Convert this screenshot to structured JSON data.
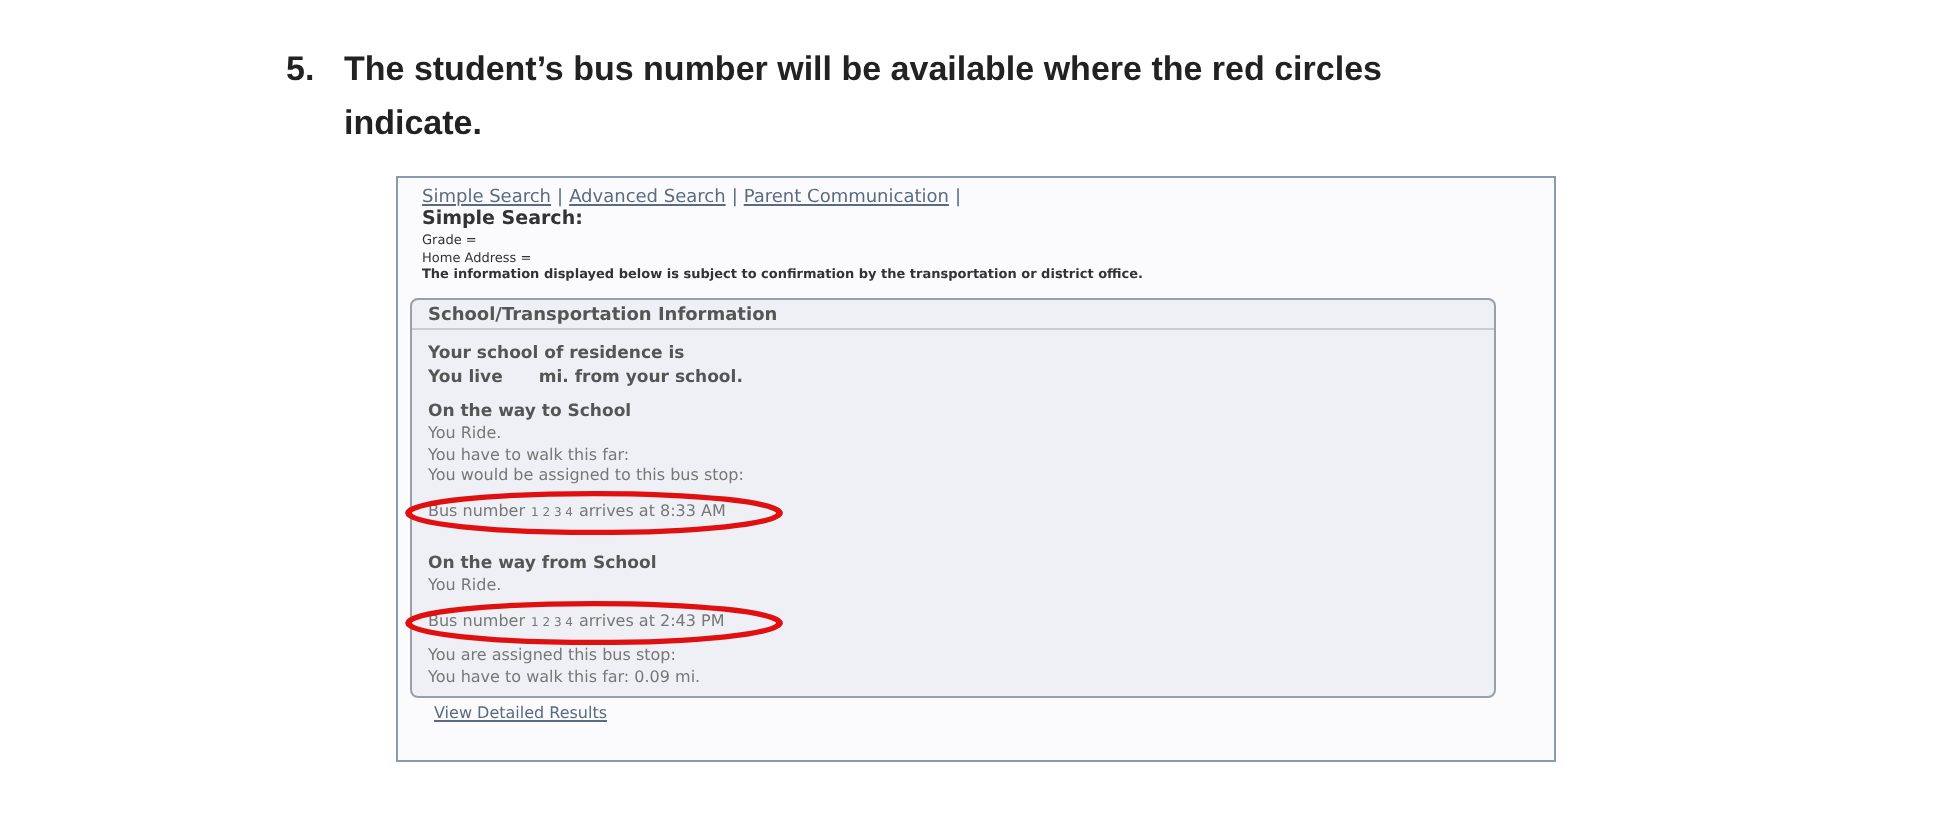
{
  "step": {
    "number": "5.",
    "text": "The student’s bus number will be available where the red circles indicate."
  },
  "screenshot": {
    "nav_links": [
      "Simple Search",
      "Advanced Search",
      "Parent Communication"
    ],
    "nav_separator": "|",
    "search_title": "Simple Search:",
    "criteria": [
      "Grade =",
      "Home Address ="
    ],
    "notice": "The information displayed below is subject to confirmation by the transportation or district office.",
    "panel": {
      "title": "School/Transportation Information",
      "residence": "Your school of residence is",
      "distance": [
        "You live",
        "mi. from your school."
      ],
      "sections": [
        {
          "heading": "On the way to School",
          "lines": [
            {
              "kind": "text",
              "text": "You Ride."
            },
            {
              "kind": "text",
              "text": "You have to walk this far:"
            },
            {
              "kind": "text",
              "text": "You would be assigned to this bus stop:"
            },
            {
              "kind": "bus",
              "prefix": "Bus number",
              "number": "1 2 3 4",
              "suffix": "arrives at 8:33 AM",
              "circled": true
            }
          ]
        },
        {
          "heading": "On the way from School",
          "lines": [
            {
              "kind": "text",
              "text": "You Ride."
            },
            {
              "kind": "bus",
              "prefix": "Bus number",
              "number": "1 2 3 4",
              "suffix": "arrives at 2:43 PM",
              "circled": true
            },
            {
              "kind": "text",
              "text": "You are assigned this bus stop:"
            },
            {
              "kind": "text",
              "text": "You have to walk this far: 0.09 mi."
            }
          ]
        }
      ]
    },
    "results_link": "View Detailed Results"
  }
}
